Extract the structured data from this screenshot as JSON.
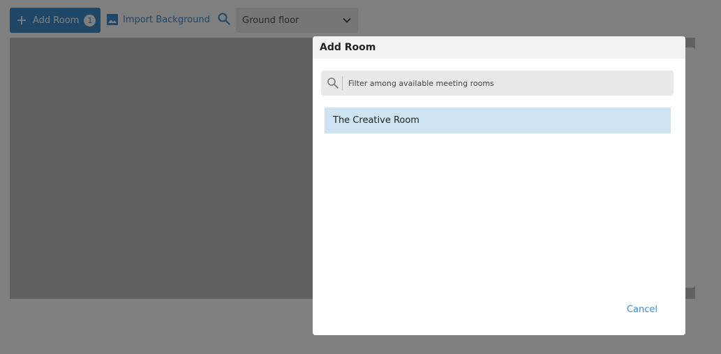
{
  "toolbar": {
    "add_room_label": "Add Room",
    "add_room_badge": "1",
    "import_background_label": "Import Background",
    "floor_select_value": "Ground floor"
  },
  "dialog": {
    "title": "Add Room",
    "filter_placeholder": "Filter among available meeting rooms",
    "rooms": [
      {
        "label": "The Creative Room"
      }
    ],
    "cancel_label": "Cancel"
  },
  "colors": {
    "accent": "#3f8fcf",
    "selected_row": "#cde3f2"
  },
  "icons": [
    "plus-icon",
    "image-icon",
    "search-icon",
    "chevron-down-icon"
  ]
}
